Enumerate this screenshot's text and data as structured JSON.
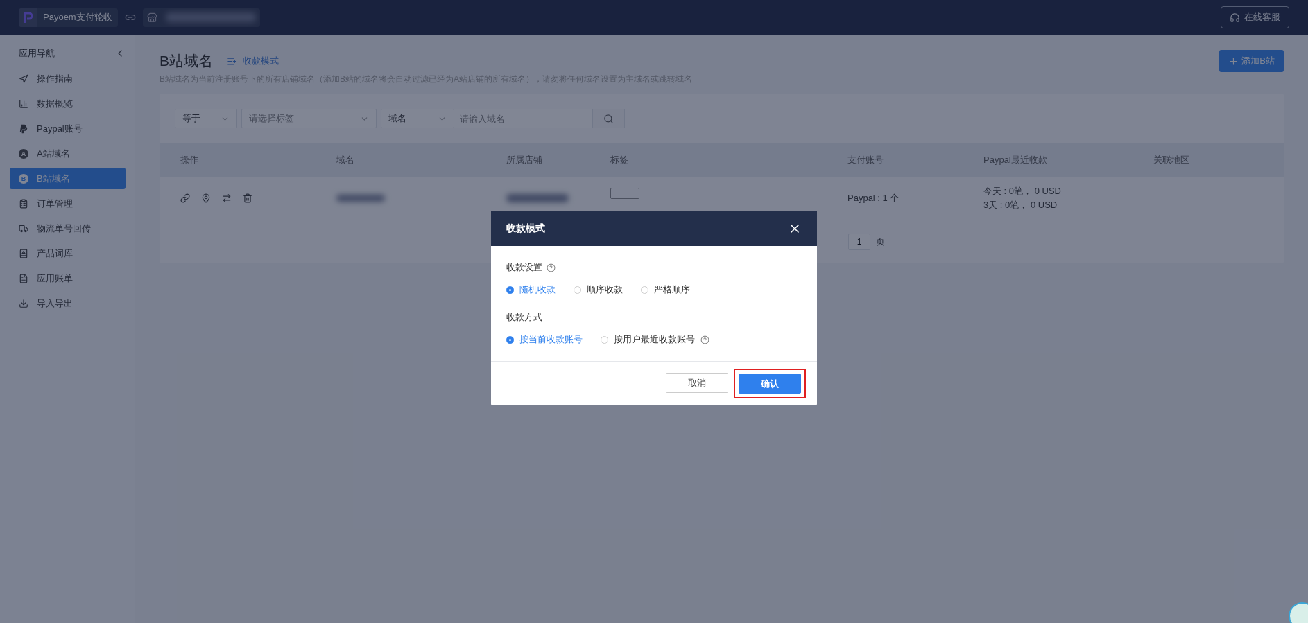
{
  "topbar": {
    "app_name": "Payoem支付轮收",
    "support_button": "在线客服"
  },
  "sidebar": {
    "title": "应用导航",
    "items": [
      {
        "label": "操作指南",
        "selected": false
      },
      {
        "label": "数据概览",
        "selected": false
      },
      {
        "label": "Paypal账号",
        "selected": false
      },
      {
        "label": "A站域名",
        "selected": false,
        "badge": "A"
      },
      {
        "label": "B站域名",
        "selected": true,
        "badge": "B"
      },
      {
        "label": "订单管理",
        "selected": false
      },
      {
        "label": "物流单号回传",
        "selected": false
      },
      {
        "label": "产品词库",
        "selected": false
      },
      {
        "label": "应用账单",
        "selected": false
      },
      {
        "label": "导入导出",
        "selected": false
      }
    ]
  },
  "page": {
    "title": "B站域名",
    "mode_link": "收款模式",
    "description": "B站域名为当前注册账号下的所有店铺域名（添加B站的域名将会自动过滤已经为A站店铺的所有域名），请勿将任何域名设置为主域名或跳转域名",
    "add_button": "添加B站"
  },
  "filters": {
    "operator": "等于",
    "tag_placeholder": "请选择标签",
    "field": "域名",
    "search_placeholder": "请输入域名"
  },
  "table": {
    "columns": [
      "操作",
      "域名",
      "所属店铺",
      "标签",
      "支付账号",
      "Paypal最近收款",
      "关联地区"
    ],
    "rows": [
      {
        "account": "Paypal : 1 个",
        "recent": [
          "今天 : 0笔， 0 USD",
          "3天 : 0笔， 0 USD"
        ]
      }
    ]
  },
  "pagination": {
    "page": "1",
    "suffix": "页"
  },
  "dialog": {
    "title": "收款模式",
    "groups": [
      {
        "label": "收款设置",
        "help": true,
        "options": [
          {
            "label": "随机收款",
            "selected": true,
            "help": false
          },
          {
            "label": "顺序收款",
            "selected": false,
            "help": false
          },
          {
            "label": "严格顺序",
            "selected": false,
            "help": false
          }
        ]
      },
      {
        "label": "收款方式",
        "help": false,
        "options": [
          {
            "label": "按当前收款账号",
            "selected": true,
            "help": false
          },
          {
            "label": "按用户最近收款账号",
            "selected": false,
            "help": true
          }
        ]
      }
    ],
    "cancel": "取消",
    "confirm": "确认",
    "confirm_highlighted": true
  }
}
